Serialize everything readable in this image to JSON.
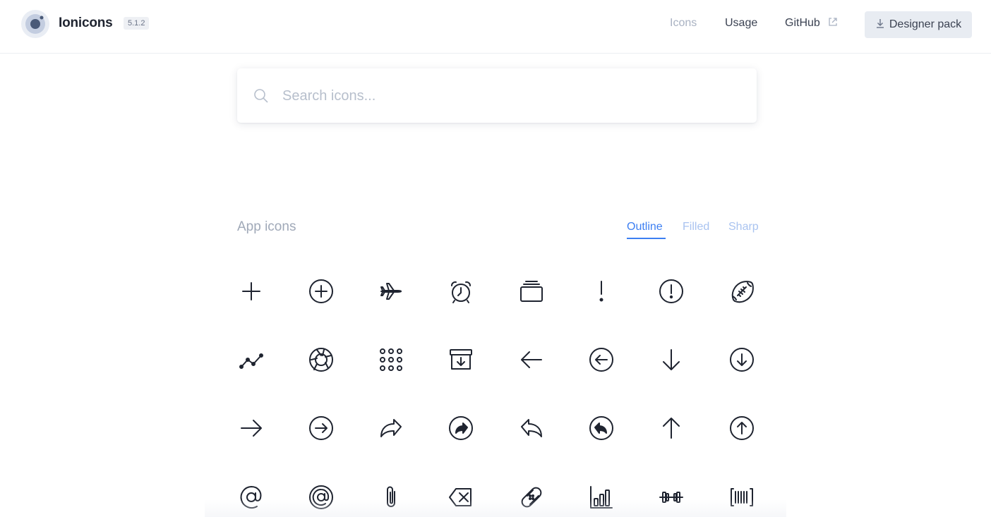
{
  "header": {
    "brand": "Ionicons",
    "version": "5.1.2",
    "nav": {
      "icons": "Icons",
      "usage": "Usage",
      "github": "GitHub"
    },
    "designer_pack": "Designer pack"
  },
  "search": {
    "placeholder": "Search icons..."
  },
  "section": {
    "title": "App icons",
    "tabs": {
      "outline": "Outline",
      "filled": "Filled",
      "sharp": "Sharp"
    },
    "active_tab": "Outline"
  },
  "colors": {
    "accent": "#3d7ff2",
    "text": "#1f2430",
    "muted": "#a0a9b8"
  },
  "icons": [
    [
      "add",
      "add-circle",
      "airplane",
      "alarm",
      "albums",
      "alert",
      "alert-circle",
      "american-football"
    ],
    [
      "analytics",
      "aperture",
      "apps",
      "archive",
      "arrow-back",
      "arrow-back-circle",
      "arrow-down",
      "arrow-down-circle"
    ],
    [
      "arrow-forward",
      "arrow-forward-circle",
      "arrow-redo",
      "arrow-redo-circle",
      "arrow-undo",
      "arrow-undo-circle",
      "arrow-up",
      "arrow-up-circle"
    ],
    [
      "at",
      "at-circle",
      "attach",
      "backspace",
      "bandage",
      "bar-chart",
      "barbell",
      "barcode"
    ]
  ]
}
